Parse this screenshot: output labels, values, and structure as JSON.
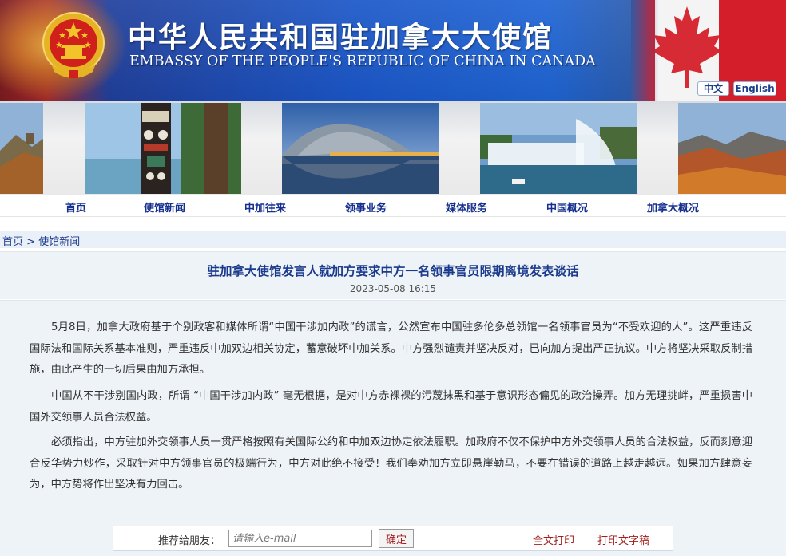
{
  "header": {
    "title_cn": "中华人民共和国驻加拿大大使馆",
    "title_en": "EMBASSY OF THE PEOPLE'S REPUBLIC OF CHINA IN CANADA",
    "lang_cn": "中文",
    "lang_en": "English"
  },
  "nav": {
    "items": [
      "首页",
      "使馆新闻",
      "中加往来",
      "领事业务",
      "媒体服务",
      "中国概况",
      "加拿大概况"
    ]
  },
  "breadcrumb": {
    "home": "首页",
    "separator": " > ",
    "current": "使馆新闻"
  },
  "article": {
    "title": "驻加拿大使馆发言人就加方要求中方一名领事官员限期离境发表谈话",
    "date": "2023-05-08 16:15",
    "paragraphs": [
      "5月8日，加拿大政府基于个别政客和媒体所谓“中国干涉加内政”的谎言，公然宣布中国驻多伦多总领馆一名领事官员为“不受欢迎的人”。这严重违反国际法和国际关系基本准则，严重违反中加双边相关协定，蓄意破坏中加关系。中方强烈谴责并坚决反对，已向加方提出严正抗议。中方将坚决采取反制措施，由此产生的一切后果由加方承担。",
      "中国从不干涉别国内政，所谓 “中国干涉加内政” 毫无根据，是对中方赤裸裸的污蔑抹黑和基于意识形态偏见的政治操弄。加方无理挑衅，严重损害中国外交领事人员合法权益。",
      "必须指出，中方驻加外交领事人员一贯严格按照有关国际公约和中加双边协定依法履职。加政府不仅不保护中方外交领事人员的合法权益，反而刻意迎合反华势力炒作，采取针对中方领事官员的极端行为，中方对此绝不接受！我们奉劝加方立即悬崖勒马，不要在错误的道路上越走越远。如果加方肆意妄为，中方势将作出坚决有力回击。"
    ]
  },
  "share": {
    "label": "推荐给朋友：",
    "placeholder": "请输入e-mail",
    "confirm": "确定",
    "print_all": "全文打印",
    "print_text": "打印文字稿"
  },
  "colors": {
    "nav_text": "#15308e",
    "title_text": "#1a3a8c",
    "link_red": "#a41b1b",
    "body_bg": "#eef3f8"
  }
}
